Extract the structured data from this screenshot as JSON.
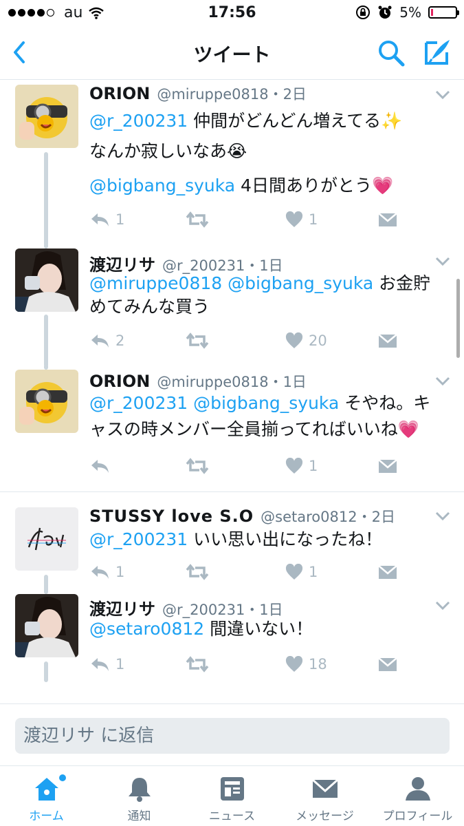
{
  "statusbar": {
    "carrier": "au",
    "time": "17:56",
    "battery": "5%"
  },
  "nav": {
    "title": "ツイート"
  },
  "tweets": [
    {
      "name": "ORION",
      "handle": "@miruppe0818・2日",
      "lines": [
        [
          {
            "t": "@r_200231",
            "m": true
          },
          {
            "t": " 仲間がどんどん増えてる✨"
          }
        ],
        [
          {
            "t": "なんか寂しいなあ😭"
          }
        ],
        [
          {
            "t": "@bigbang_syuka",
            "m": true
          },
          {
            "t": " 4日間ありがとう💗"
          }
        ]
      ],
      "replies": "1",
      "retweets": "",
      "likes": "1"
    },
    {
      "name": "渡辺リサ",
      "handle": "@r_200231・1日",
      "lines": [
        [
          {
            "t": "@miruppe0818",
            "m": true
          },
          {
            "t": " "
          },
          {
            "t": "@bigbang_syuka",
            "m": true
          },
          {
            "t": " お金貯"
          }
        ],
        [
          {
            "t": "めてみんな買う"
          }
        ]
      ],
      "replies": "2",
      "retweets": "",
      "likes": "20"
    },
    {
      "name": "ORION",
      "handle": "@miruppe0818・1日",
      "lines": [
        [
          {
            "t": "@r_200231",
            "m": true
          },
          {
            "t": " "
          },
          {
            "t": "@bigbang_syuka",
            "m": true
          },
          {
            "t": " そやね。キ"
          }
        ],
        [
          {
            "t": "ャスの時メンバー全員揃ってればいいね💗"
          }
        ]
      ],
      "replies": "",
      "retweets": "",
      "likes": "1"
    },
    {
      "name": "STUSSY love S.O",
      "handle": "@setaro0812・2日",
      "lines": [
        [
          {
            "t": "@r_200231",
            "m": true
          },
          {
            "t": " いい思い出になったね！"
          }
        ]
      ],
      "replies": "1",
      "retweets": "",
      "likes": "1"
    },
    {
      "name": "渡辺リサ",
      "handle": "@r_200231・1日",
      "lines": [
        [
          {
            "t": "@setaro0812",
            "m": true
          },
          {
            "t": " 間違いない！"
          }
        ]
      ],
      "replies": "1",
      "retweets": "",
      "likes": "18"
    }
  ],
  "reply": {
    "placeholder": "渡辺リサ に返信"
  },
  "tabs": [
    {
      "label": "ホーム",
      "icon": "home-icon"
    },
    {
      "label": "通知",
      "icon": "bell-icon"
    },
    {
      "label": "ニュース",
      "icon": "news-icon"
    },
    {
      "label": "メッセージ",
      "icon": "mail-icon"
    },
    {
      "label": "プロフィール",
      "icon": "person-icon"
    }
  ],
  "colors": {
    "accent": "#1da1f2",
    "muted": "#aab8c2",
    "text": "#14171a",
    "divider": "#e1e8ed"
  }
}
